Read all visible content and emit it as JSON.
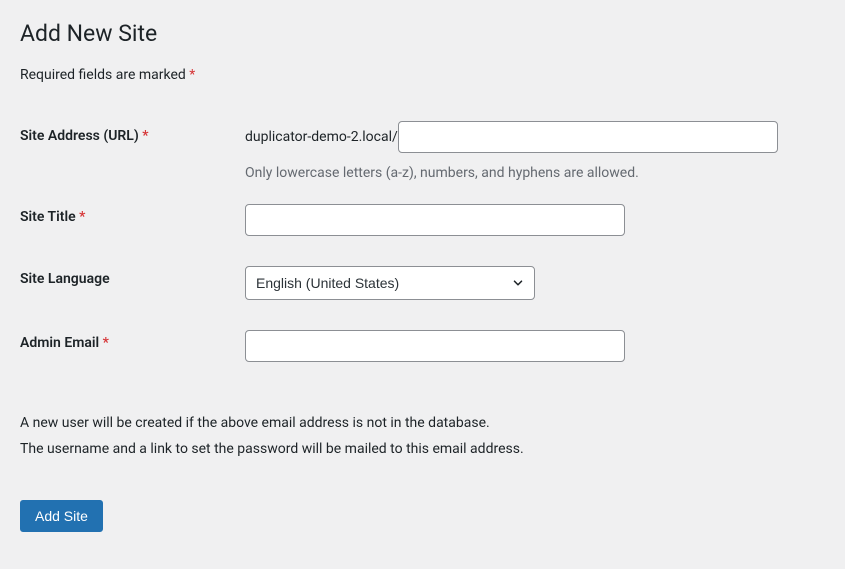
{
  "page_title": "Add New Site",
  "required_note": "Required fields are marked",
  "required_marker": "*",
  "fields": {
    "site_address": {
      "label": "Site Address (URL)",
      "required_marker": "*",
      "prefix": "duplicator-demo-2.local/",
      "value": "",
      "description": "Only lowercase letters (a-z), numbers, and hyphens are allowed."
    },
    "site_title": {
      "label": "Site Title",
      "required_marker": "*",
      "value": ""
    },
    "site_language": {
      "label": "Site Language",
      "selected": "English (United States)"
    },
    "admin_email": {
      "label": "Admin Email",
      "required_marker": "*",
      "value": ""
    }
  },
  "helper": {
    "line1": "A new user will be created if the above email address is not in the database.",
    "line2": "The username and a link to set the password will be mailed to this email address."
  },
  "submit_label": "Add Site"
}
